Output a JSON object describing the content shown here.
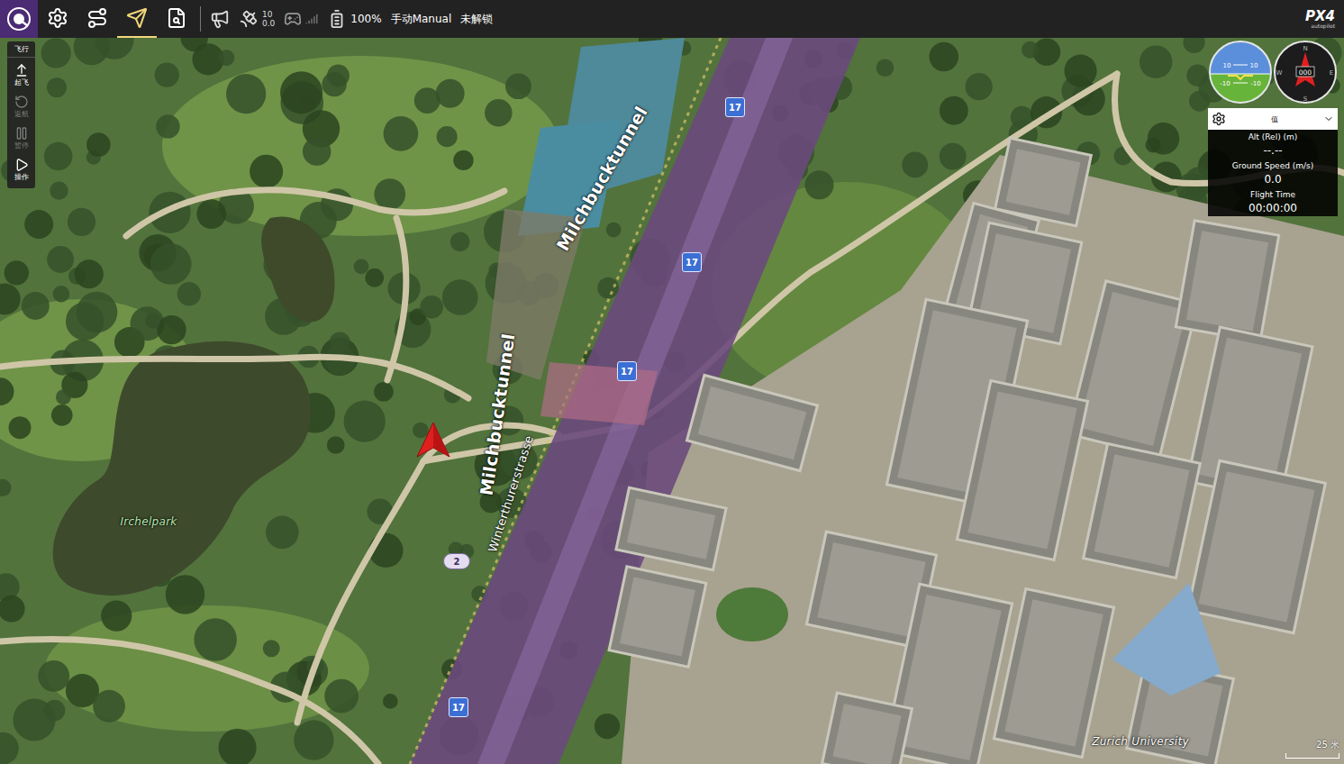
{
  "toolbar": {
    "views": [
      {
        "selected": false
      },
      {
        "selected": false
      },
      {
        "selected": true
      },
      {
        "selected": false
      }
    ],
    "gps": {
      "count": "10",
      "hdop": "0.0"
    },
    "battery": "100%",
    "flight_mode": "手动Manual",
    "arm_state": "未解锁",
    "logo": {
      "text": "PX4",
      "subtext": "autopilot"
    }
  },
  "fly_tools": {
    "title": "飞行",
    "items": [
      {
        "label": "起飞",
        "disabled": false
      },
      {
        "label": "返航",
        "disabled": true
      },
      {
        "label": "暂停",
        "disabled": true
      },
      {
        "label": "操作",
        "disabled": false
      }
    ]
  },
  "map": {
    "labels": [
      {
        "text": "Milchbucktunnel",
        "kind": "road"
      },
      {
        "text": "Milchbucktunnel",
        "kind": "road"
      },
      {
        "text": "Winterthurerstrasse",
        "kind": "street"
      },
      {
        "text": "Irchelpark",
        "kind": "park"
      },
      {
        "text": "Zurich University",
        "kind": "place"
      }
    ],
    "route_badges": [
      {
        "text": "17",
        "kind": "highway"
      },
      {
        "text": "17",
        "kind": "highway"
      },
      {
        "text": "17",
        "kind": "highway"
      },
      {
        "text": "17",
        "kind": "highway"
      },
      {
        "text": "2",
        "kind": "road"
      }
    ],
    "scale": "25 米"
  },
  "instruments": {
    "attitude_ticks": [
      "10",
      "10",
      "-10",
      "-10"
    ],
    "compass": {
      "cardinals": [
        "N",
        "E",
        "S",
        "W"
      ],
      "heading": "000"
    }
  },
  "values_panel": {
    "header": "值",
    "rows": [
      {
        "label": "Alt (Rel) (m)",
        "value": "--.--"
      },
      {
        "label": "Ground Speed (m/s)",
        "value": "0.0"
      },
      {
        "label": "Flight Time",
        "value": "00:00:00"
      }
    ]
  }
}
